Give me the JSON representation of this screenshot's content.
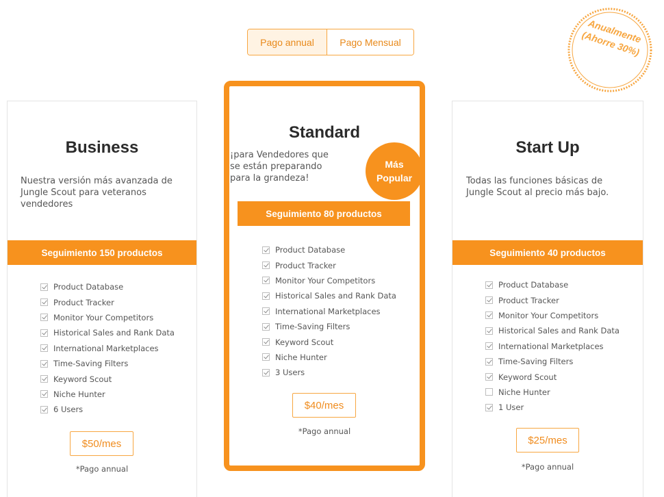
{
  "billing_toggle": {
    "annual_label": "Pago annual",
    "monthly_label": "Pago Mensual",
    "selected": "annual"
  },
  "stamp": {
    "line1": "Anualmente",
    "line2": "(Ahorre 30%)"
  },
  "colors": {
    "accent": "#f7921e",
    "accent_light": "#fff3e3",
    "text": "#555555"
  },
  "plans": {
    "business": {
      "title": "Business",
      "desc_line1": "Nuestra versión más avanzada de",
      "desc_line2": "Jungle Scout para veteranos",
      "desc_line3": "vendedores",
      "band": "Seguimiento 150 productos",
      "features": [
        {
          "label": "Product Database",
          "checked": true
        },
        {
          "label": "Product Tracker",
          "checked": true
        },
        {
          "label": "Monitor Your Competitors",
          "checked": true
        },
        {
          "label": "Historical Sales and Rank Data",
          "checked": true
        },
        {
          "label": "International Marketplaces",
          "checked": true
        },
        {
          "label": "Time-Saving Filters",
          "checked": true
        },
        {
          "label": "Keyword Scout",
          "checked": true
        },
        {
          "label": "Niche Hunter",
          "checked": true
        },
        {
          "label": "6 Users",
          "checked": true
        }
      ],
      "price": "$50/mes",
      "note": "*Pago annual"
    },
    "standard": {
      "title": "Standard",
      "desc_line1": "¡para Vendedores que",
      "desc_line2": "se están preparando",
      "desc_line3": "para la grandeza!",
      "badge_line1": "Más",
      "badge_line2": "Popular",
      "band": "Seguimiento 80 productos",
      "features": [
        {
          "label": "Product Database",
          "checked": true
        },
        {
          "label": "Product Tracker",
          "checked": true
        },
        {
          "label": "Monitor Your Competitors",
          "checked": true
        },
        {
          "label": "Historical Sales and Rank Data",
          "checked": true
        },
        {
          "label": "International Marketplaces",
          "checked": true
        },
        {
          "label": "Time-Saving Filters",
          "checked": true
        },
        {
          "label": "Keyword Scout",
          "checked": true
        },
        {
          "label": "Niche Hunter",
          "checked": true
        },
        {
          "label": "3 Users",
          "checked": true
        }
      ],
      "price": "$40/mes",
      "note": "*Pago annual"
    },
    "startup": {
      "title": "Start Up",
      "desc_line1": "Todas las funciones básicas de",
      "desc_line2": "Jungle Scout al precio más bajo.",
      "band": "Seguimiento 40 productos",
      "features": [
        {
          "label": "Product Database",
          "checked": true
        },
        {
          "label": "Product Tracker",
          "checked": true
        },
        {
          "label": "Monitor Your Competitors",
          "checked": true
        },
        {
          "label": "Historical Sales and Rank Data",
          "checked": true
        },
        {
          "label": "International Marketplaces",
          "checked": true
        },
        {
          "label": "Time-Saving Filters",
          "checked": true
        },
        {
          "label": "Keyword Scout",
          "checked": true
        },
        {
          "label": "Niche Hunter",
          "checked": false
        },
        {
          "label": "1 User",
          "checked": true
        }
      ],
      "price": "$25/mes",
      "note": "*Pago annual"
    }
  }
}
